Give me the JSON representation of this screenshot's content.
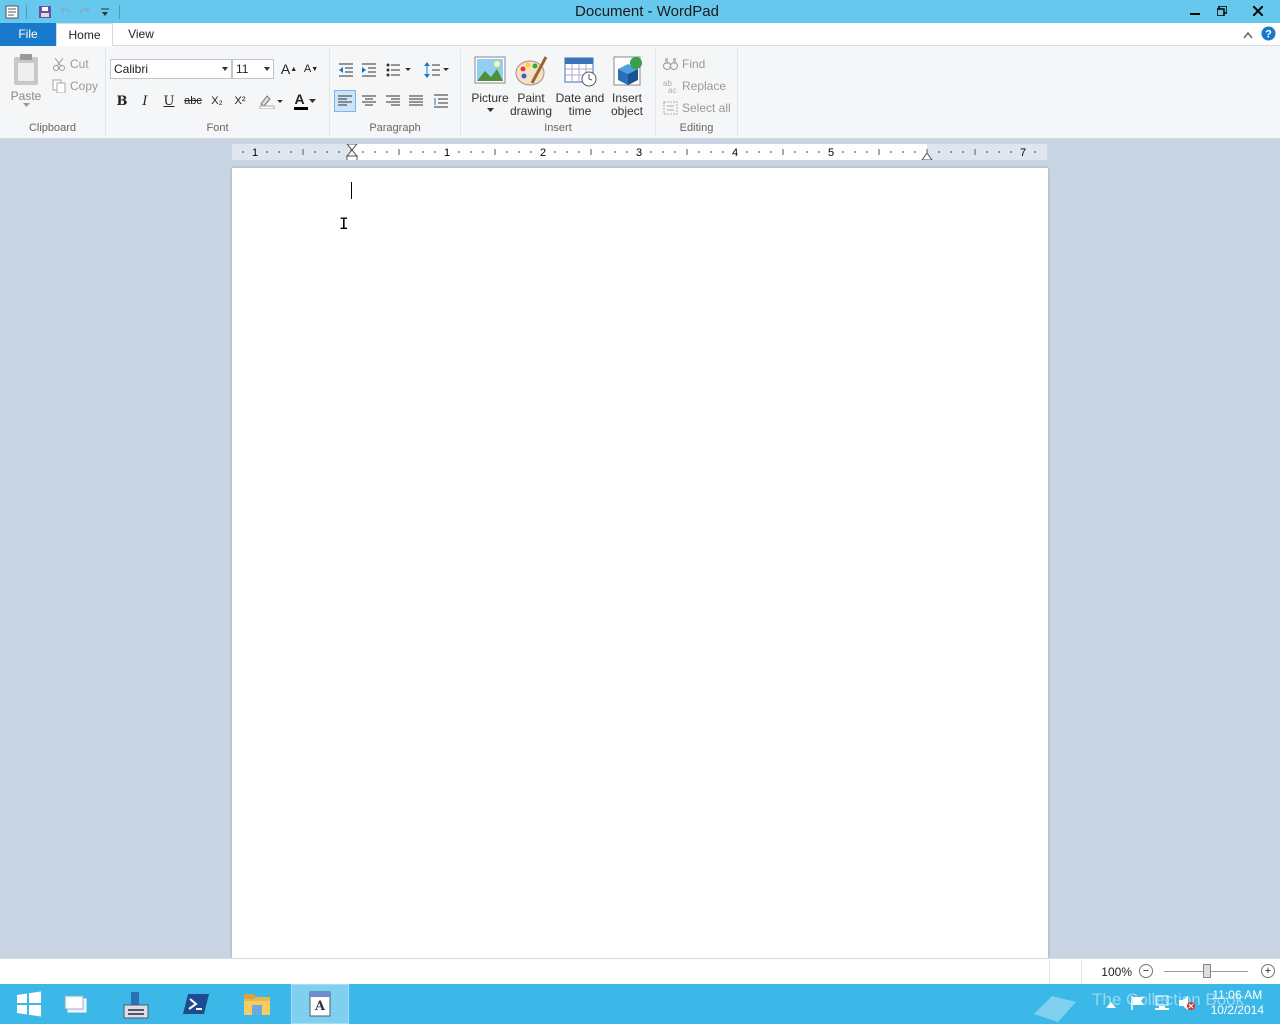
{
  "window": {
    "title": "Document - WordPad"
  },
  "ribbon_tabs": {
    "file": "File",
    "home": "Home",
    "view": "View"
  },
  "clipboard": {
    "paste": "Paste",
    "cut": "Cut",
    "copy": "Copy",
    "group_label": "Clipboard"
  },
  "font": {
    "family": "Calibri",
    "size": "11",
    "group_label": "Font",
    "bold": "B",
    "italic": "I",
    "underline": "U",
    "strikethrough": "abc",
    "subscript": "X₂",
    "superscript": "X²",
    "grow": "A",
    "shrink": "A",
    "font_color": "A"
  },
  "paragraph": {
    "group_label": "Paragraph"
  },
  "insert": {
    "picture": "Picture",
    "paint_drawing_1": "Paint",
    "paint_drawing_2": "drawing",
    "date_time_1": "Date and",
    "date_time_2": "time",
    "insert_object_1": "Insert",
    "insert_object_2": "object",
    "group_label": "Insert"
  },
  "editing": {
    "find": "Find",
    "replace": "Replace",
    "select_all": "Select all",
    "group_label": "Editing"
  },
  "ruler": {
    "labels": [
      "1",
      "1",
      "2",
      "3",
      "4",
      "5",
      "7"
    ]
  },
  "status": {
    "zoom": "100%",
    "zoom_minus": "−",
    "zoom_plus": "+"
  },
  "taskbar": {
    "time": "11:06 AM",
    "date": "10/2/2014",
    "watermark": "The Collection Book"
  }
}
